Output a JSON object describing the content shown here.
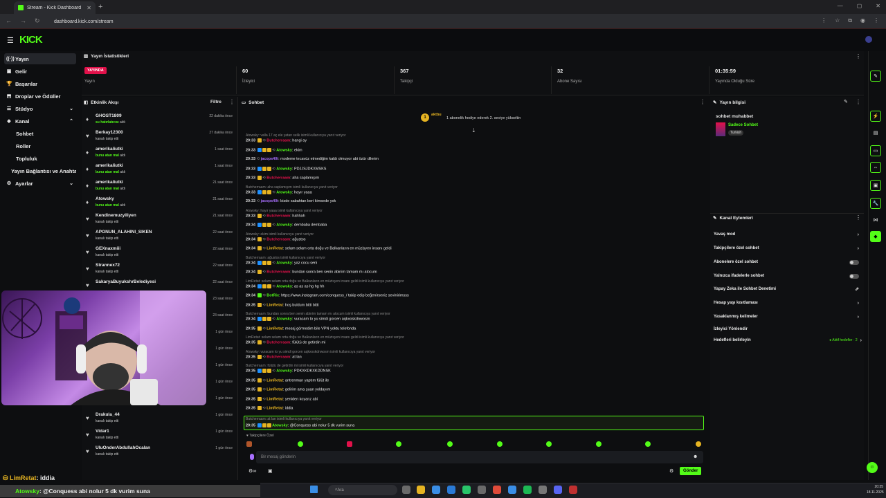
{
  "browser": {
    "tab_title": "Stream - Kick Dashboard",
    "url": "dashboard.kick.com/stream",
    "window_controls": [
      "—",
      "▢",
      "✕"
    ],
    "nav_icons": [
      "←",
      "→",
      "↻"
    ],
    "addr_icons": [
      "⋮",
      "☆",
      "⧉",
      "◉",
      "⋮"
    ]
  },
  "header": {
    "logo": "KICK"
  },
  "sidebar": {
    "items": [
      {
        "label": "Yayın",
        "icon": "((·))"
      },
      {
        "label": "Gelir",
        "icon": "▣"
      },
      {
        "label": "Başarılar",
        "icon": "🏆"
      },
      {
        "label": "Droplar ve Ödüller",
        "icon": "⬒"
      },
      {
        "label": "Stüdyo",
        "icon": "☰"
      },
      {
        "label": "Kanal",
        "icon": "◈"
      },
      {
        "label": "Sohbet"
      },
      {
        "label": "Roller"
      },
      {
        "label": "Topluluk"
      },
      {
        "label": "Yayın Bağlantısı ve Anahtarı"
      },
      {
        "label": "Ayarlar",
        "icon": "⚙"
      }
    ]
  },
  "stats": {
    "title": "Yayın İstatistikleri",
    "live_badge": "YAYINDA",
    "live_label": "Yayın",
    "items": [
      {
        "value": "60",
        "label": "İzleyici"
      },
      {
        "value": "367",
        "label": "Takipçi"
      },
      {
        "value": "32",
        "label": "Abone Sayısı"
      },
      {
        "value": "01:35:59",
        "label": "Yayında Olduğu Süre"
      }
    ]
  },
  "activity": {
    "title": "Etkinlik Akışı",
    "filter": "Filtre",
    "rows": [
      {
        "name": "GHOST1809",
        "sub_pre": "",
        "sub_hl": "su hatırlatıcısı",
        "sub_post": " aldı",
        "time": "22 dakika önce",
        "icon": "♦"
      },
      {
        "name": "Berkay12300",
        "sub_pre": "kanalı takip etti",
        "sub_hl": "",
        "sub_post": "",
        "time": "27 dakika önce",
        "icon": "♥"
      },
      {
        "name": "amerikaliutki",
        "sub_pre": "",
        "sub_hl": "bunu atan mal",
        "sub_post": " aldı",
        "time": "1 saat önce",
        "icon": "♦"
      },
      {
        "name": "amerikaliutki",
        "sub_pre": "",
        "sub_hl": "bunu atan mal",
        "sub_post": " aldı",
        "time": "1 saat önce",
        "icon": "♦"
      },
      {
        "name": "amerikaliutki",
        "sub_pre": "",
        "sub_hl": "bunu atan mal",
        "sub_post": " aldı",
        "time": "21 saat önce",
        "icon": "♦"
      },
      {
        "name": "Atowsky",
        "sub_pre": "",
        "sub_hl": "bunu atan mal",
        "sub_post": " aldı",
        "time": "21 saat önce",
        "icon": "♦"
      },
      {
        "name": "Kendinemuzyiliyen",
        "sub_pre": "kanalı takip etti",
        "sub_hl": "",
        "sub_post": "",
        "time": "21 saat önce",
        "icon": "♥"
      },
      {
        "name": "APONUN_ALAHINI_SIKEN",
        "sub_pre": "kanalı takip etti",
        "sub_hl": "",
        "sub_post": "",
        "time": "22 saat önce",
        "icon": "♥"
      },
      {
        "name": "GEXnaxmiii",
        "sub_pre": "kanalı takip etti",
        "sub_hl": "",
        "sub_post": "",
        "time": "22 saat önce",
        "icon": "♥"
      },
      {
        "name": "Strannex72",
        "sub_pre": "kanalı takip etti",
        "sub_hl": "",
        "sub_post": "",
        "time": "22 saat önce",
        "icon": "♥"
      },
      {
        "name": "SakaryaBuyukshrBelediyesi",
        "sub_pre": "",
        "sub_hl": "",
        "sub_post": "",
        "time": "22 saat önce",
        "icon": "♥"
      },
      {
        "name": "",
        "sub_pre": "",
        "sub_hl": "",
        "sub_post": "",
        "time": "23 saat önce",
        "icon": ""
      },
      {
        "name": "",
        "sub_pre": "",
        "sub_hl": "",
        "sub_post": "",
        "time": "23 saat önce",
        "icon": ""
      },
      {
        "name": "",
        "sub_pre": "",
        "sub_hl": "",
        "sub_post": "",
        "time": "1 gün önce",
        "icon": ""
      },
      {
        "name": "",
        "sub_pre": "",
        "sub_hl": "",
        "sub_post": "",
        "time": "1 gün önce",
        "icon": ""
      },
      {
        "name": "",
        "sub_pre": "",
        "sub_hl": "",
        "sub_post": "",
        "time": "1 gün önce",
        "icon": ""
      },
      {
        "name": "",
        "sub_pre": "",
        "sub_hl": "",
        "sub_post": "",
        "time": "1 gün önce",
        "icon": ""
      },
      {
        "name": "Atowsky",
        "sub_pre": "",
        "sub_hl": "bunu atan mal",
        "sub_post": " aldı",
        "time": "1 gün önce",
        "icon": "♦"
      },
      {
        "name": "Drakula_44",
        "sub_pre": "kanalı takip etti",
        "sub_hl": "",
        "sub_post": "",
        "time": "1 gün önce",
        "icon": "♥"
      },
      {
        "name": "Vidar1",
        "sub_pre": "kanalı takip etti",
        "sub_hl": "",
        "sub_post": "",
        "time": "1 gün önce",
        "icon": "♥"
      },
      {
        "name": "UluOnderAbdullahOcalan",
        "sub_pre": "kanalı takip etti",
        "sub_hl": "",
        "sub_post": "",
        "time": "1 gün önce",
        "icon": "♥"
      }
    ]
  },
  "chat": {
    "title": "Sohbet",
    "gift_user": "aktbu",
    "gift_text": "1 abonelik hediye ederek 2. seviye yükseltin",
    "lines": [
      {
        "t": "reply",
        "text": "Atowsky: valla 17 aç ele yatan selik isimli kullanıcıya yanıt veriyor"
      },
      {
        "t": "msg",
        "time": "20:33",
        "user": "Butcherraam",
        "color": "#e1114a",
        "msg": ": hangi ay",
        "badges": [
          "#e6b422"
        ]
      },
      {
        "t": "msg",
        "time": "20:33",
        "user": "Atowsky",
        "color": "#53fc18",
        "msg": ": ekim",
        "badges": [
          "#1e90ff",
          "#e6b422",
          "#e6b422"
        ]
      },
      {
        "t": "msg",
        "time": "20:33",
        "user": "jacops40t",
        "color": "#a970ff",
        "msg": ": modeme tecavüz etmediğim kaldı olmuyor abi özür dilerim",
        "badges": []
      },
      {
        "t": "msg",
        "time": "20:33",
        "user": "Atowsky",
        "color": "#53fc18",
        "msg": ": PDJJSJDKXMSKS",
        "badges": [
          "#1e90ff",
          "#e6b422",
          "#e6b422"
        ]
      },
      {
        "t": "msg",
        "time": "20:33",
        "user": "Butcherraam",
        "color": "#e1114a",
        "msg": ": aha saplamışım",
        "badges": [
          "#e6b422"
        ]
      },
      {
        "t": "reply",
        "text": "Butcherraam: aha saplamışım isimli kullanıcıya yanıt veriyor"
      },
      {
        "t": "msg",
        "time": "20:33",
        "user": "Atowsky",
        "color": "#53fc18",
        "msg": ": hayır yaaa",
        "badges": [
          "#1e90ff",
          "#e6b422",
          "#e6b422"
        ]
      },
      {
        "t": "msg",
        "time": "20:33",
        "user": "jacops40t",
        "color": "#a970ff",
        "msg": ": bizde sabahtan beri kimsede yok",
        "badges": []
      },
      {
        "t": "reply",
        "text": "Atowsky: hayır yaaa isimli kullanıcıya yanıt veriyor"
      },
      {
        "t": "msg",
        "time": "20:33",
        "user": "Butcherraam",
        "color": "#e1114a",
        "msg": ": hahhah",
        "badges": [
          "#e6b422"
        ]
      },
      {
        "t": "msg",
        "time": "20:34",
        "user": "Atowsky",
        "color": "#53fc18",
        "msg": ": dembaba dembaba",
        "badges": [
          "#1e90ff",
          "#e6b422",
          "#e6b422"
        ]
      },
      {
        "t": "reply",
        "text": "Atowsky: ekim isimli kullanıcıya yanıt veriyor"
      },
      {
        "t": "msg",
        "time": "20:34",
        "user": "Butcherraam",
        "color": "#e1114a",
        "msg": ": ağustos",
        "badges": [
          "#e6b422"
        ]
      },
      {
        "t": "msg",
        "time": "20:34",
        "user": "LimRetat",
        "color": "#e6b422",
        "msg": ": selam selam orta doğu ve Balkanların en müzisyen insanı geldi",
        "badges": [
          "#e6b422"
        ]
      },
      {
        "t": "reply",
        "text": "Butcherraam: ağustos isimli kullanıcıya yanıt veriyor"
      },
      {
        "t": "msg",
        "time": "20:34",
        "user": "Atowsky",
        "color": "#53fc18",
        "msg": ": yaz cocu seni",
        "badges": [
          "#1e90ff",
          "#e6b422",
          "#e6b422"
        ]
      },
      {
        "t": "msg",
        "time": "20:34",
        "user": "Butcherraam",
        "color": "#e1114a",
        "msg": ": bundan sonra ben senin abinim tamam mı atocum",
        "badges": [
          "#e6b422"
        ]
      },
      {
        "t": "reply",
        "text": "LimRetat: selam selam orta doğu ve Balkanların en müzisyen insanı geldi isimli kullanıcıya yanıt veriyor"
      },
      {
        "t": "msg",
        "time": "20:34",
        "user": "Atowsky",
        "color": "#53fc18",
        "msg": ": as as as hg hg hh",
        "badges": [
          "#1e90ff",
          "#e6b422",
          "#e6b422"
        ]
      },
      {
        "t": "msg",
        "time": "20:34",
        "user": "BotRix",
        "color": "#53fc18",
        "msg": ": https://www.instagram.com/conquess_/ takip edip beğenirseniz sevinirimsss",
        "badges": [
          "#53fc18"
        ]
      },
      {
        "t": "msg",
        "time": "20:35",
        "user": "LimRetat",
        "color": "#e6b422",
        "msg": ": hoş buldum bitti bitti",
        "badges": [
          "#e6b422"
        ]
      },
      {
        "t": "reply",
        "text": "Butcherraam: bundan sonra ben senin abinim tamam mı atocum isimli kullanıcıya yanıt veriyor"
      },
      {
        "t": "msg",
        "time": "20:34",
        "user": "Atowsky",
        "color": "#53fc18",
        "msg": ": vuracam to yu simdi gorcen aqkxoskdnwosm",
        "badges": [
          "#1e90ff",
          "#e6b422",
          "#e6b422"
        ]
      },
      {
        "t": "msg",
        "time": "20:35",
        "user": "LimRetat",
        "color": "#e6b422",
        "msg": ": mesaj görmedim bile VPN yoktu telefonda",
        "badges": [
          "#e6b422"
        ]
      },
      {
        "t": "reply",
        "text": "LimRetat: selam selam orta doğu ve Balkanların en müzisyen insanı geldi isimli kullanıcıya yanıt veriyor"
      },
      {
        "t": "msg",
        "time": "20:35",
        "user": "Butcherraam",
        "color": "#e1114a",
        "msg": ": fülütü de getirdin mi",
        "badges": [
          "#e6b422"
        ]
      },
      {
        "t": "reply",
        "text": "Atowsky: vuracam to yu simdi gorcen aqkxoskdnwosm isimli kullanıcıya yanıt veriyor"
      },
      {
        "t": "msg",
        "time": "20:35",
        "user": "Butcherraam",
        "color": "#e1114a",
        "msg": ": at lan",
        "badges": [
          "#e6b422"
        ]
      },
      {
        "t": "reply",
        "text": "Butcherraam: fülütü de getirdin mi isimli kullanıcıya yanıt veriyor"
      },
      {
        "t": "msg",
        "time": "20:35",
        "user": "Atowsky",
        "color": "#53fc18",
        "msg": ": PDKXKDKXKDDNSK",
        "badges": [
          "#1e90ff",
          "#e6b422",
          "#e6b422"
        ]
      },
      {
        "t": "msg",
        "time": "20:35",
        "user": "LimRetat",
        "color": "#e6b422",
        "msg": ": antrenman yaptım fülüt ile",
        "badges": [
          "#e6b422"
        ]
      },
      {
        "t": "msg",
        "time": "20:35",
        "user": "LimRetat",
        "color": "#e6b422",
        "msg": ": gelirim ama şuan yoldayım",
        "badges": [
          "#e6b422"
        ]
      },
      {
        "t": "msg",
        "time": "20:35",
        "user": "LimRetat",
        "color": "#e6b422",
        "msg": ": yeniden koyanz abi",
        "badges": [
          "#e6b422"
        ]
      },
      {
        "t": "msg",
        "time": "20:35",
        "user": "LimRetat",
        "color": "#e6b422",
        "msg": ": iddia",
        "badges": [
          "#e6b422"
        ]
      }
    ],
    "highlight": {
      "reply": "Butcherraam: at lan isimli kullanıcıya yanıt veriyor",
      "time": "20:35",
      "user": "Atowsky",
      "msg": ": @Conquess abi nolur 5 dk vurim suna"
    },
    "followers_only": "Takipçilere Özel",
    "input_placeholder": "Bir mesaj gönderin",
    "send": "Gönder"
  },
  "stream_info": {
    "title": "Yayın bilgisi",
    "stream_title": "sohbet muhabbet",
    "category": "Sadece Sohbet",
    "tag": "Turkish"
  },
  "channel_actions": {
    "title": "Kanal Eylemleri",
    "items": [
      {
        "label": "Yavaş mod",
        "right": "›"
      },
      {
        "label": "Takipçilere özel sohbet",
        "right": "›"
      },
      {
        "label": "Abonelere özel sohbet",
        "right": "toggle"
      },
      {
        "label": "Yalnızca ifadelerle sohbet",
        "right": "toggle"
      },
      {
        "label": "Yapay Zeka ile Sohbet Denetimi",
        "right": "⇗"
      },
      {
        "label": "Hesap yaşı kısıtlaması",
        "right": "›"
      },
      {
        "label": "Yasaklanmış kelimeler",
        "right": "›"
      },
      {
        "label": "İzleyici Yönlendir",
        "right": ""
      },
      {
        "label": "Hedefleri belirleyin",
        "right": "›",
        "extra": "● Aktif hedefler · 2"
      }
    ]
  },
  "overlay": {
    "line1_user": "LimRetat",
    "line1_msg": ": iddia",
    "line2_user": "Atowsky",
    "line2_msg": ": @Conquess abi nolur 5 dk vurim suna"
  },
  "taskbar": {
    "search": "Ara",
    "time": "20:35",
    "date": "18.11.2025"
  }
}
